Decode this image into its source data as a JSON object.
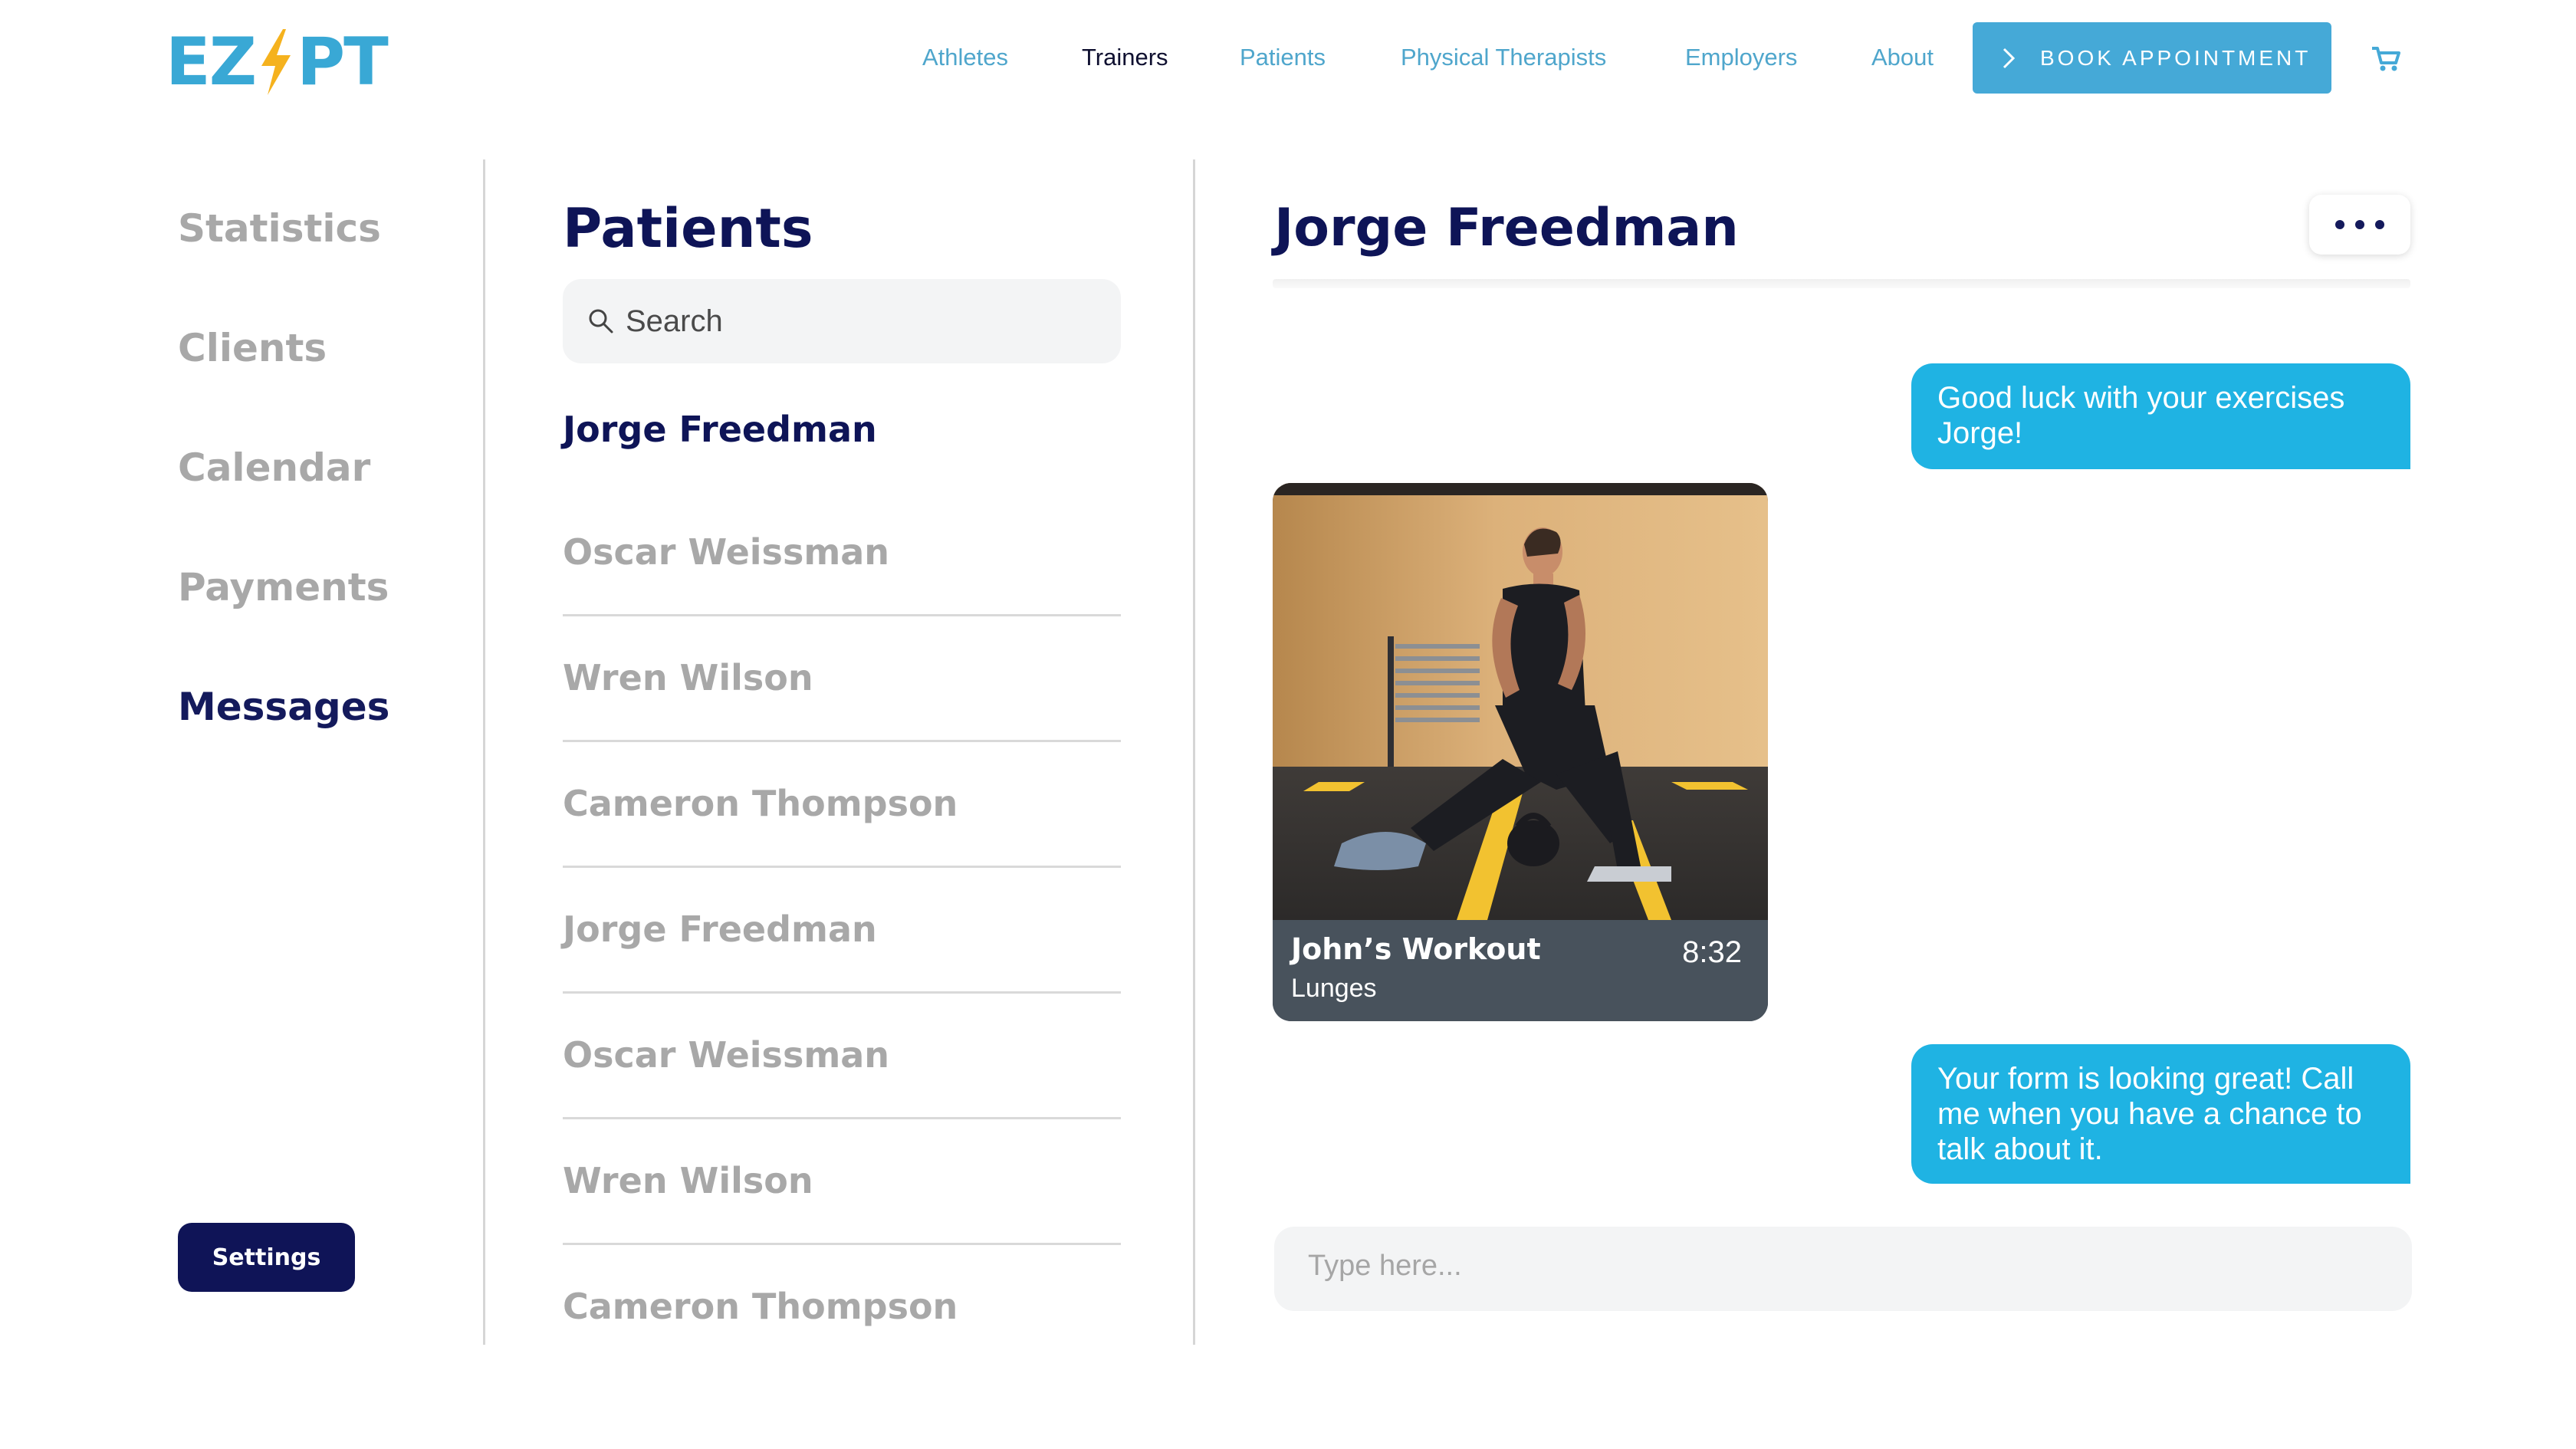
{
  "logo": {
    "left": "EZ",
    "right": "PT"
  },
  "nav": {
    "items": [
      {
        "label": "Athletes",
        "active": false
      },
      {
        "label": "Trainers",
        "active": true
      },
      {
        "label": "Patients",
        "active": false
      },
      {
        "label": "Physical Therapists",
        "active": false
      },
      {
        "label": "Employers",
        "active": false
      },
      {
        "label": "About",
        "active": false
      }
    ],
    "book_label": "BOOK APPOINTMENT"
  },
  "sidebar": {
    "items": [
      {
        "label": "Statistics",
        "active": false
      },
      {
        "label": "Clients",
        "active": false
      },
      {
        "label": "Calendar",
        "active": false
      },
      {
        "label": "Payments",
        "active": false
      },
      {
        "label": "Messages",
        "active": true
      }
    ],
    "settings_label": "Settings"
  },
  "patients": {
    "title": "Patients",
    "search_placeholder": "Search",
    "list": [
      "Jorge Freedman",
      "Oscar Weissman",
      "Wren Wilson",
      "Cameron Thompson",
      "Jorge Freedman",
      "Oscar Weissman",
      "Wren Wilson",
      "Cameron Thompson"
    ]
  },
  "chat": {
    "title": "Jorge Freedman",
    "messages": {
      "first": "Good luck with your exercises Jorge!",
      "second": "Your form is looking great! Call me when you have a chance to talk about it."
    },
    "video": {
      "title": "John’s Workout",
      "subtitle": "Lunges",
      "duration": "8:32"
    },
    "input_placeholder": "Type here..."
  },
  "colors": {
    "brand_blue": "#39a8d5",
    "brand_yellow": "#f5b21e",
    "navy": "#0e1457",
    "bubble": "#1fb3e3",
    "book_button": "#45a9d7"
  }
}
